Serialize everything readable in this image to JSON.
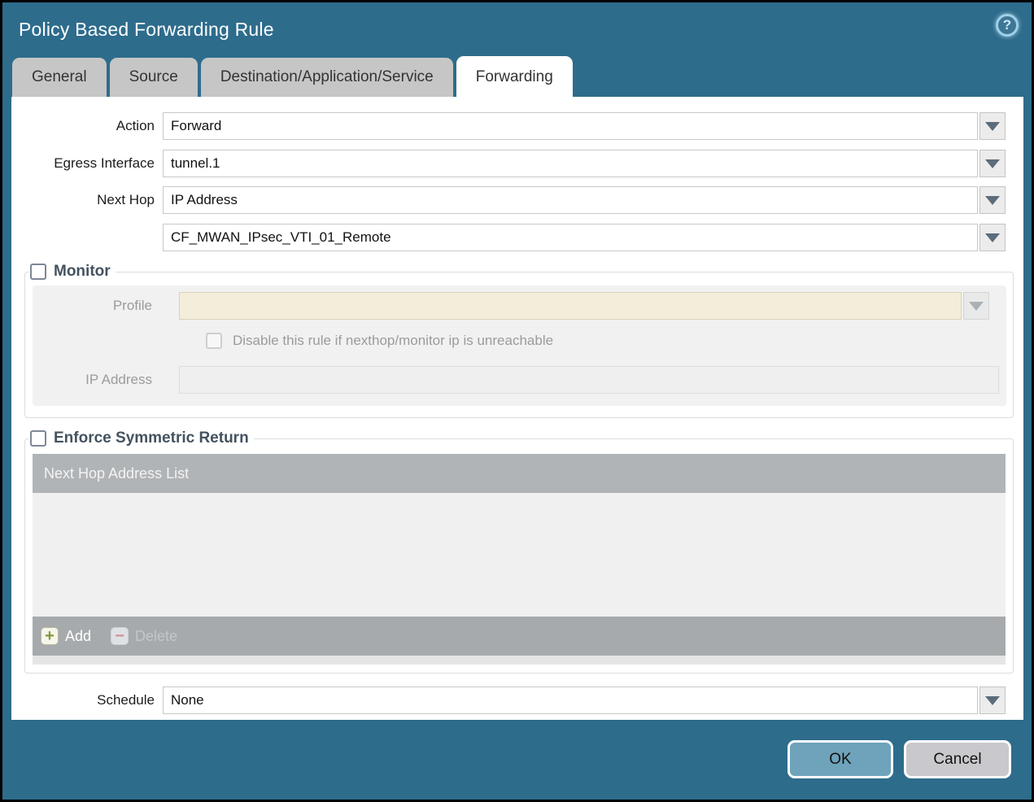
{
  "window": {
    "title": "Policy Based Forwarding Rule"
  },
  "icons": {
    "help": "?",
    "add": "+",
    "delete": "−",
    "dropdown": "▼"
  },
  "colors": {
    "titlebar_teal": "#2e6c8c",
    "tab_inactive": "#c6c6c6",
    "active_tab_bg": "#ffffff",
    "disabled_field_cream": "#f3edd9",
    "table_header_gray": "#b0b4b7",
    "ok_button": "#6ea3bb",
    "cancel_button": "#c9c9cd"
  },
  "tabs": [
    {
      "label": "General",
      "active": false
    },
    {
      "label": "Source",
      "active": false
    },
    {
      "label": "Destination/Application/Service",
      "active": false
    },
    {
      "label": "Forwarding",
      "active": true
    }
  ],
  "form": {
    "action": {
      "label": "Action",
      "value": "Forward"
    },
    "egress_interface": {
      "label": "Egress Interface",
      "value": "tunnel.1"
    },
    "next_hop": {
      "label": "Next Hop",
      "value": "IP Address"
    },
    "next_hop_address": {
      "value": "CF_MWAN_IPsec_VTI_01_Remote"
    },
    "schedule": {
      "label": "Schedule",
      "value": "None"
    }
  },
  "monitor": {
    "label": "Monitor",
    "checked": false,
    "profile": {
      "label": "Profile",
      "value": ""
    },
    "disable_rule": {
      "label": "Disable this rule if nexthop/monitor ip is unreachable",
      "checked": false
    },
    "ip_address": {
      "label": "IP Address",
      "value": ""
    }
  },
  "symmetric_return": {
    "label": "Enforce Symmetric Return",
    "checked": false,
    "table": {
      "header": "Next Hop Address List",
      "rows": []
    },
    "add_label": "Add",
    "delete_label": "Delete"
  },
  "footer": {
    "ok": "OK",
    "cancel": "Cancel"
  }
}
